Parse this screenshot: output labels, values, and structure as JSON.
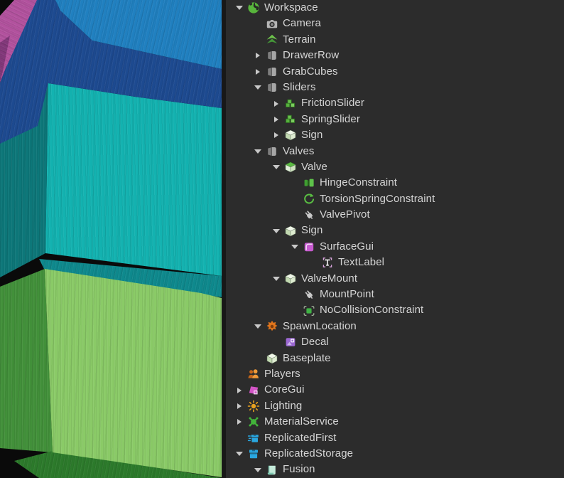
{
  "colors": {
    "panel_background": "#2c2c2c",
    "divider": "#181818",
    "tree_text": "#d4d4d4",
    "tree_arrow": "#c8c8c8",
    "viewport_background": "#0a0a0a"
  },
  "viewport": {
    "faces": [
      {
        "name": "teal-block-left",
        "color": "#0d7779"
      },
      {
        "name": "teal-block-front",
        "color": "#13b2b0"
      },
      {
        "name": "teal-block-bottom",
        "color": "#0e898d"
      },
      {
        "name": "blue-block-side",
        "color": "#1d4a90"
      },
      {
        "name": "magenta-block",
        "color": "#b2529e"
      },
      {
        "name": "magenta-block-edge",
        "color": "#82387a"
      },
      {
        "name": "blue-block-front",
        "color": "#2080c0"
      },
      {
        "name": "green-block-left",
        "color": "#42903a"
      },
      {
        "name": "green-block-bottom",
        "color": "#2c7a2b"
      },
      {
        "name": "green-block-front",
        "color": "#8aca67"
      }
    ]
  },
  "explorer": {
    "items": [
      {
        "label": "Workspace",
        "icon": "workspace",
        "level": 0,
        "arrow": "expanded"
      },
      {
        "label": "Camera",
        "icon": "camera",
        "level": 1,
        "arrow": "none"
      },
      {
        "label": "Terrain",
        "icon": "terrain",
        "level": 1,
        "arrow": "none"
      },
      {
        "label": "DrawerRow",
        "icon": "model",
        "level": 1,
        "arrow": "collapsed"
      },
      {
        "label": "GrabCubes",
        "icon": "model",
        "level": 1,
        "arrow": "collapsed"
      },
      {
        "label": "Sliders",
        "icon": "model",
        "level": 1,
        "arrow": "expanded"
      },
      {
        "label": "FrictionSlider",
        "icon": "model-green",
        "level": 2,
        "arrow": "collapsed"
      },
      {
        "label": "SpringSlider",
        "icon": "model-green",
        "level": 2,
        "arrow": "collapsed"
      },
      {
        "label": "Sign",
        "icon": "part",
        "level": 2,
        "arrow": "collapsed"
      },
      {
        "label": "Valves",
        "icon": "model",
        "level": 1,
        "arrow": "expanded"
      },
      {
        "label": "Valve",
        "icon": "valve",
        "level": 2,
        "arrow": "expanded"
      },
      {
        "label": "HingeConstraint",
        "icon": "hinge",
        "level": 3,
        "arrow": "none"
      },
      {
        "label": "TorsionSpringConstraint",
        "icon": "torsion-spring",
        "level": 3,
        "arrow": "none"
      },
      {
        "label": "ValvePivot",
        "icon": "attachment",
        "level": 3,
        "arrow": "none"
      },
      {
        "label": "Sign",
        "icon": "part",
        "level": 2,
        "arrow": "expanded"
      },
      {
        "label": "SurfaceGui",
        "icon": "surfacegui",
        "level": 3,
        "arrow": "expanded"
      },
      {
        "label": "TextLabel",
        "icon": "textlabel",
        "level": 4,
        "arrow": "none"
      },
      {
        "label": "ValveMount",
        "icon": "part",
        "level": 2,
        "arrow": "expanded"
      },
      {
        "label": "MountPoint",
        "icon": "attachment",
        "level": 3,
        "arrow": "none"
      },
      {
        "label": "NoCollisionConstraint",
        "icon": "nocollision",
        "level": 3,
        "arrow": "none"
      },
      {
        "label": "SpawnLocation",
        "icon": "spawnlocation",
        "level": 1,
        "arrow": "expanded"
      },
      {
        "label": "Decal",
        "icon": "decal",
        "level": 2,
        "arrow": "none"
      },
      {
        "label": "Baseplate",
        "icon": "part",
        "level": 1,
        "arrow": "none"
      },
      {
        "label": "Players",
        "icon": "players",
        "level": 0,
        "arrow": "none"
      },
      {
        "label": "CoreGui",
        "icon": "coregui",
        "level": 0,
        "arrow": "collapsed"
      },
      {
        "label": "Lighting",
        "icon": "lighting",
        "level": 0,
        "arrow": "collapsed"
      },
      {
        "label": "MaterialService",
        "icon": "materialservice",
        "level": 0,
        "arrow": "collapsed"
      },
      {
        "label": "ReplicatedFirst",
        "icon": "replicatedfirst",
        "level": 0,
        "arrow": "none"
      },
      {
        "label": "ReplicatedStorage",
        "icon": "replicatedstorage",
        "level": 0,
        "arrow": "expanded"
      },
      {
        "label": "Fusion",
        "icon": "modulescript",
        "level": 1,
        "arrow": "expanded"
      }
    ]
  }
}
